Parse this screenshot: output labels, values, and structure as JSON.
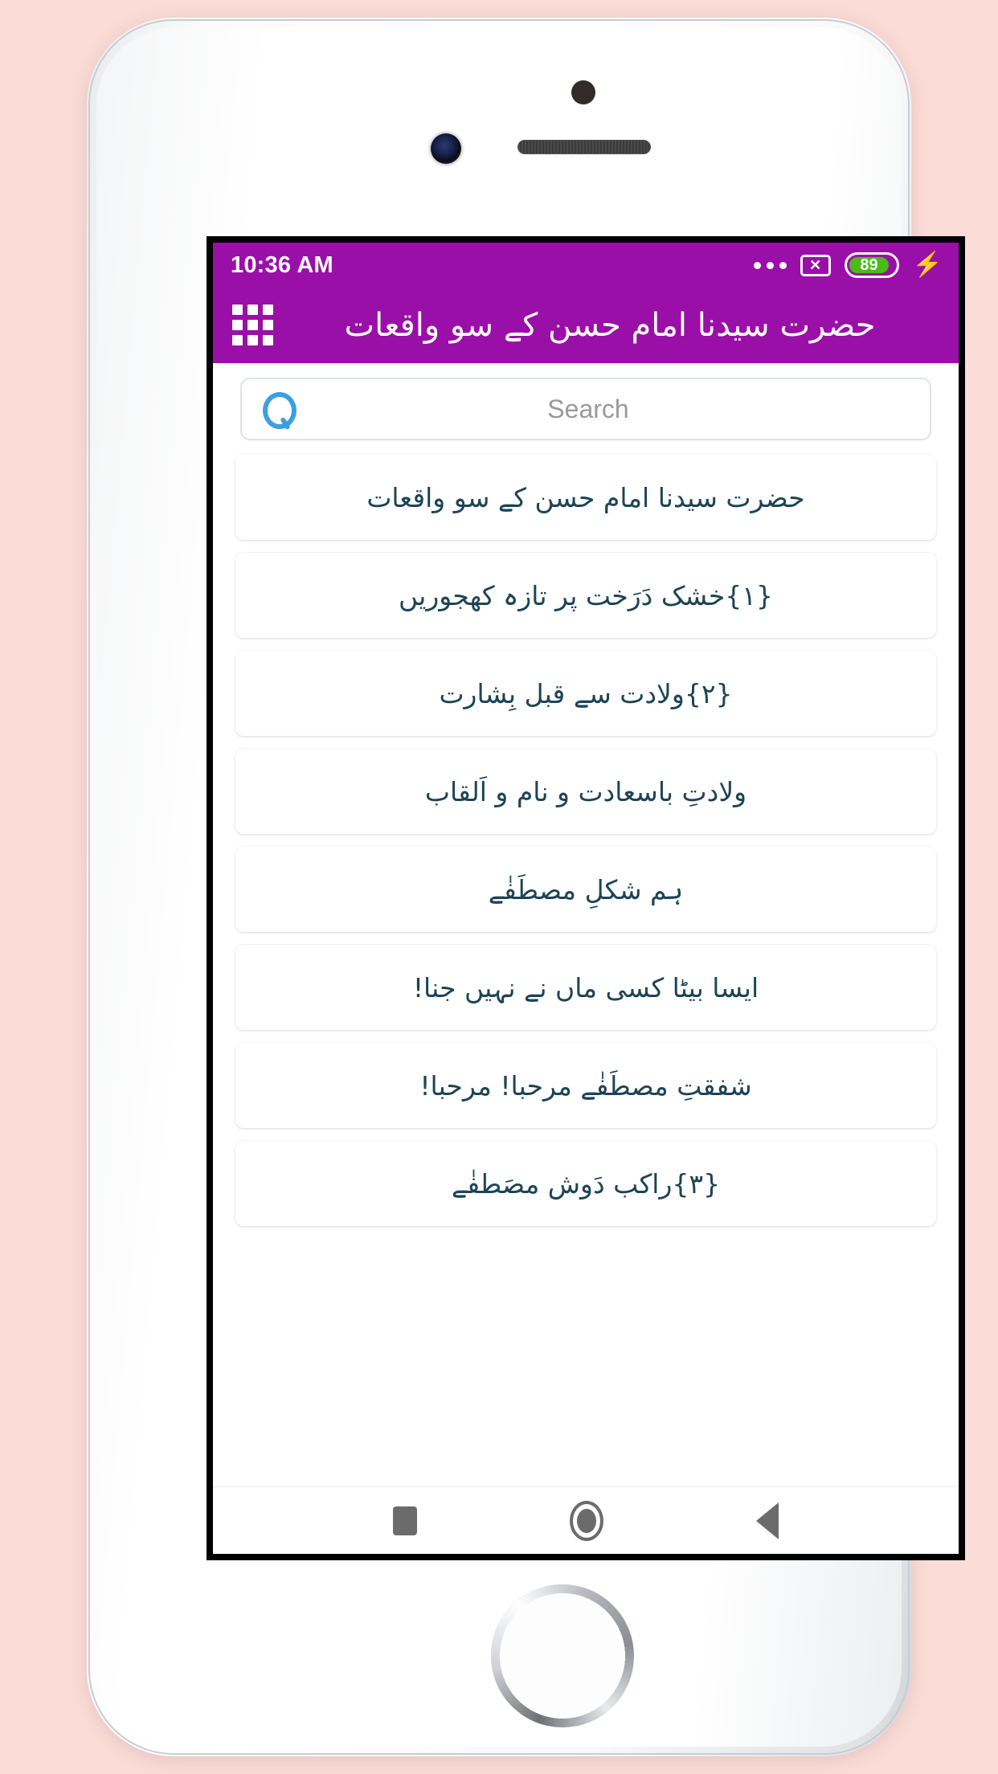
{
  "device": {
    "frame": "smartphone-mockup",
    "background_color": "#fbdcd7",
    "body_color": "#ffffff"
  },
  "status_bar": {
    "time": "10:36 AM",
    "background_color": "#9a0fa8",
    "more_icon": "overflow-dots-icon",
    "no_sim_icon": "no-sim-icon",
    "no_sim_glyph": "✕",
    "battery_level": "89",
    "battery_color": "#4cbb17",
    "charging_icon": "lightning-bolt-icon",
    "charging_glyph": "⚡"
  },
  "app_bar": {
    "menu_icon": "grid-menu-icon",
    "title": "حضرت سیدنا امام حسن کے سو واقعات",
    "background_color": "#9a0fa8",
    "text_color": "#ffffff"
  },
  "search": {
    "icon": "search-icon",
    "placeholder": "Search",
    "value": "",
    "icon_color": "#3c9fe0"
  },
  "list": {
    "text_color": "#1d4455",
    "items": [
      {
        "label": "حضرت سیدنا امام حسن کے سو واقعات"
      },
      {
        "label": "{۱}خشک دَرَخت پر تازہ کھجوریں"
      },
      {
        "label": "{۲}ولادت سے قبل بِشارت"
      },
      {
        "label": "ولادتِ باسعادت و نام و اَلقاب"
      },
      {
        "label": "ہم شکلِ مصطَفٰے"
      },
      {
        "label": "ایسا بیٹا کسی ماں نے نہیں جنا!"
      },
      {
        "label": "شفقتِ مصطَفٰے مرحبا! مرحبا!"
      },
      {
        "label": "{۳}راکب دَوش مصَطفٰے"
      }
    ]
  },
  "nav_bar": {
    "recents_icon": "square-recents-icon",
    "home_icon": "circle-home-icon",
    "back_icon": "triangle-back-icon"
  }
}
